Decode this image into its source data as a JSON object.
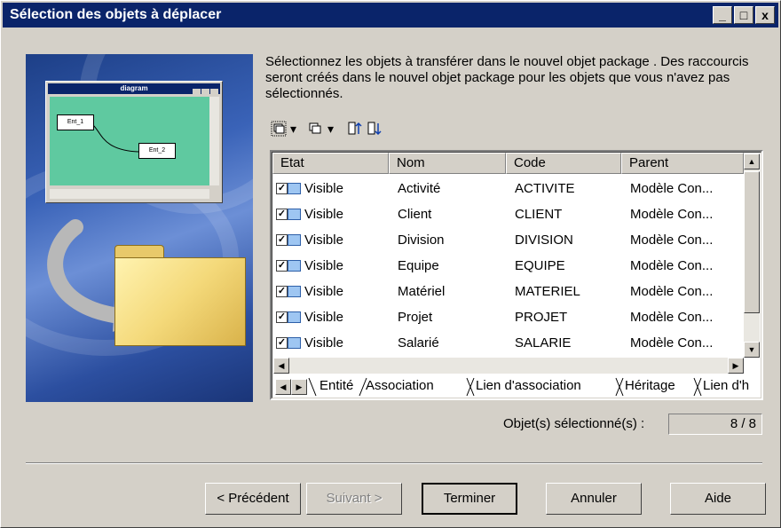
{
  "window": {
    "title": "Sélection des objets à déplacer",
    "buttons": [
      "_",
      "□",
      "x"
    ]
  },
  "instructions": "Sélectionnez les objets à transférer dans le nouvel objet package . Des raccourcis seront créés dans le nouvel objet package pour les objets que vous n'avez pas sélectionnés.",
  "illustration": {
    "mini_title": "diagram",
    "entities": [
      "Ent_1",
      "Ent_2"
    ]
  },
  "toolbar": {
    "icons": [
      "select-all-icon",
      "deselect-icon",
      "sort-asc-icon",
      "sort-desc-icon"
    ],
    "dropdown_arrow": "▾"
  },
  "table": {
    "columns": [
      "Etat",
      "Nom",
      "Code",
      "Parent"
    ],
    "rows": [
      {
        "etat": "Visible",
        "nom": "Activité",
        "code": "ACTIVITE",
        "parent": "Modèle Con..."
      },
      {
        "etat": "Visible",
        "nom": "Client",
        "code": "CLIENT",
        "parent": "Modèle Con..."
      },
      {
        "etat": "Visible",
        "nom": "Division",
        "code": "DIVISION",
        "parent": "Modèle Con..."
      },
      {
        "etat": "Visible",
        "nom": "Equipe",
        "code": "EQUIPE",
        "parent": "Modèle Con..."
      },
      {
        "etat": "Visible",
        "nom": "Matériel",
        "code": "MATERIEL",
        "parent": "Modèle Con..."
      },
      {
        "etat": "Visible",
        "nom": "Projet",
        "code": "PROJET",
        "parent": "Modèle Con..."
      },
      {
        "etat": "Visible",
        "nom": "Salarié",
        "code": "SALARIE",
        "parent": "Modèle Con..."
      }
    ]
  },
  "tabs": [
    "Entité",
    "Association",
    "Lien d'association",
    "Héritage",
    "Lien d'h"
  ],
  "status": {
    "label": "Objet(s) sélectionné(s) :",
    "value": "8 / 8"
  },
  "buttons": {
    "previous": "< Précédent",
    "next": "Suivant >",
    "finish": "Terminer",
    "cancel": "Annuler",
    "help": "Aide"
  }
}
